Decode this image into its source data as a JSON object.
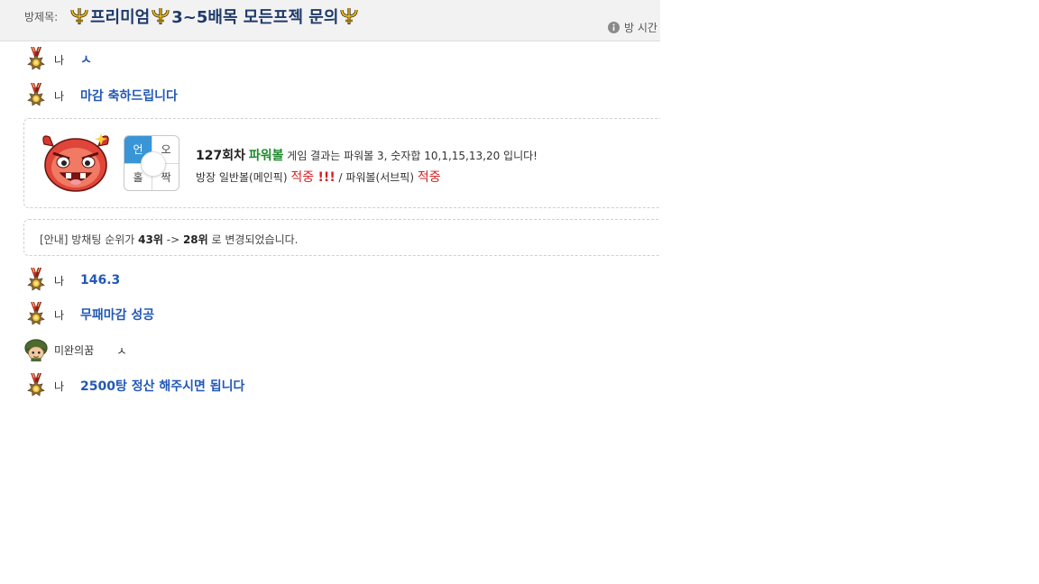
{
  "header": {
    "room_label": "방제목:",
    "title_parts": [
      "프리미엄",
      "3~5배목 모든프젝 문의"
    ],
    "meta_label": "방 시간"
  },
  "messages": [
    {
      "nick": "나",
      "text": "ㅅ",
      "avatar": "medal-avatar"
    },
    {
      "nick": "나",
      "text": "마감 축하드립니다",
      "avatar": "medal-avatar"
    },
    {
      "nick": "나",
      "text": "146.3",
      "avatar": "medal-avatar"
    },
    {
      "nick": "나",
      "text": "무패마감 성공",
      "avatar": "medal-avatar"
    },
    {
      "nick": "미완의꿈",
      "text": "ㅅ",
      "avatar": "soldier-avatar"
    },
    {
      "nick": "나",
      "text": "2500탕 정산 해주시면 됩니다",
      "avatar": "medal-avatar"
    }
  ],
  "result": {
    "grid": {
      "top_left": "언",
      "top_right": "오",
      "bottom_left": "홀",
      "bottom_right": "짝",
      "selected": "언"
    },
    "round": "127회차",
    "game": "파워볼",
    "line1_rest": "게임 결과는 파워볼 3, 숫자합 10,1,15,13,20 입니다!",
    "line2_main_label": "방장 일반볼(메인픽)",
    "line2_main_result": "적중",
    "line2_main_excl": "!!!",
    "line2_sep": "/",
    "line2_sub_label": "파워볼(서브픽)",
    "line2_sub_result": "적중"
  },
  "notice": {
    "prefix": "[안내] 방채팅 순위가",
    "from_rank": "43위",
    "arrow": "->",
    "to_rank": "28위",
    "suffix": "로 변경되었습니다."
  },
  "colors": {
    "accent_blue": "#2359b6",
    "game_green": "#1f8a2e",
    "hit_red": "#d62020",
    "title_navy": "#1f3a6b",
    "selected_cell": "#3a95d6"
  }
}
